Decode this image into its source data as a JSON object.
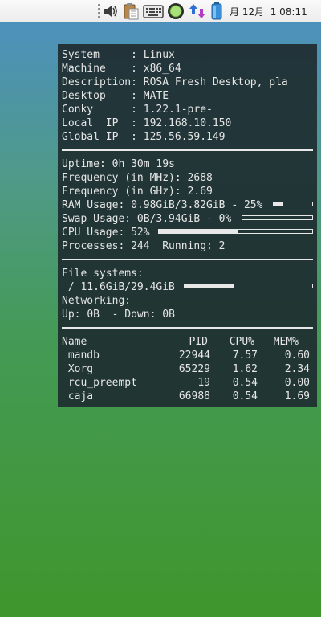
{
  "panel": {
    "clock": "月 12月  1 08:11",
    "icons": [
      "volume-icon",
      "clipboard-icon",
      "keyboard-icon",
      "update-notifier-icon",
      "network-transfer-icon",
      "battery-icon"
    ]
  },
  "conky": {
    "system_info": [
      {
        "label": "System     : ",
        "value": "Linux"
      },
      {
        "label": "Machine    : ",
        "value": "x86_64"
      },
      {
        "label": "Description: ",
        "value": "ROSA Fresh Desktop, pla"
      },
      {
        "label": "Desktop    : ",
        "value": "MATE"
      },
      {
        "label": "Conky      : ",
        "value": "1.22.1-pre-"
      },
      {
        "label": "Local  IP  : ",
        "value": "192.168.10.150"
      },
      {
        "label": "Global IP  : ",
        "value": "125.56.59.149"
      }
    ],
    "uptime": {
      "label": "Uptime: ",
      "value": "0h 30m 19s"
    },
    "freq_mhz": {
      "label": "Frequency (in MHz): ",
      "value": "2688"
    },
    "freq_ghz": {
      "label": "Frequency (in GHz): ",
      "value": "2.69"
    },
    "ram": {
      "label": "RAM Usage: ",
      "value": "0.98GiB/3.82GiB - 25%",
      "percent": 25
    },
    "swap": {
      "label": "Swap Usage: ",
      "value": "0B/3.94GiB - 0%",
      "percent": 0
    },
    "cpu": {
      "label": "CPU Usage: ",
      "value": "52%",
      "percent": 52
    },
    "processes": {
      "label": "Processes: ",
      "value": "244",
      "running_label": "  Running: ",
      "running_value": "2"
    },
    "filesystems": {
      "label": "File systems:",
      "root": " / 11.6GiB/29.4GiB",
      "percent": 39
    },
    "networking": {
      "label": "Networking:",
      "up_label": "Up: ",
      "up_value": "0B",
      "down_label": "  - Down: ",
      "down_value": "0B"
    },
    "table": {
      "headers": {
        "name": "Name",
        "pid": "PID",
        "cpu": "CPU%",
        "mem": "MEM%"
      },
      "rows": [
        {
          "name": " mandb",
          "pid": "22944",
          "cpu": "7.57",
          "mem": "0.60"
        },
        {
          "name": " Xorg",
          "pid": "65229",
          "cpu": "1.62",
          "mem": "2.34"
        },
        {
          "name": " rcu_preempt",
          "pid": "19",
          "cpu": "0.54",
          "mem": "0.00"
        },
        {
          "name": " caja",
          "pid": "66988",
          "cpu": "0.54",
          "mem": "1.69"
        }
      ]
    }
  }
}
